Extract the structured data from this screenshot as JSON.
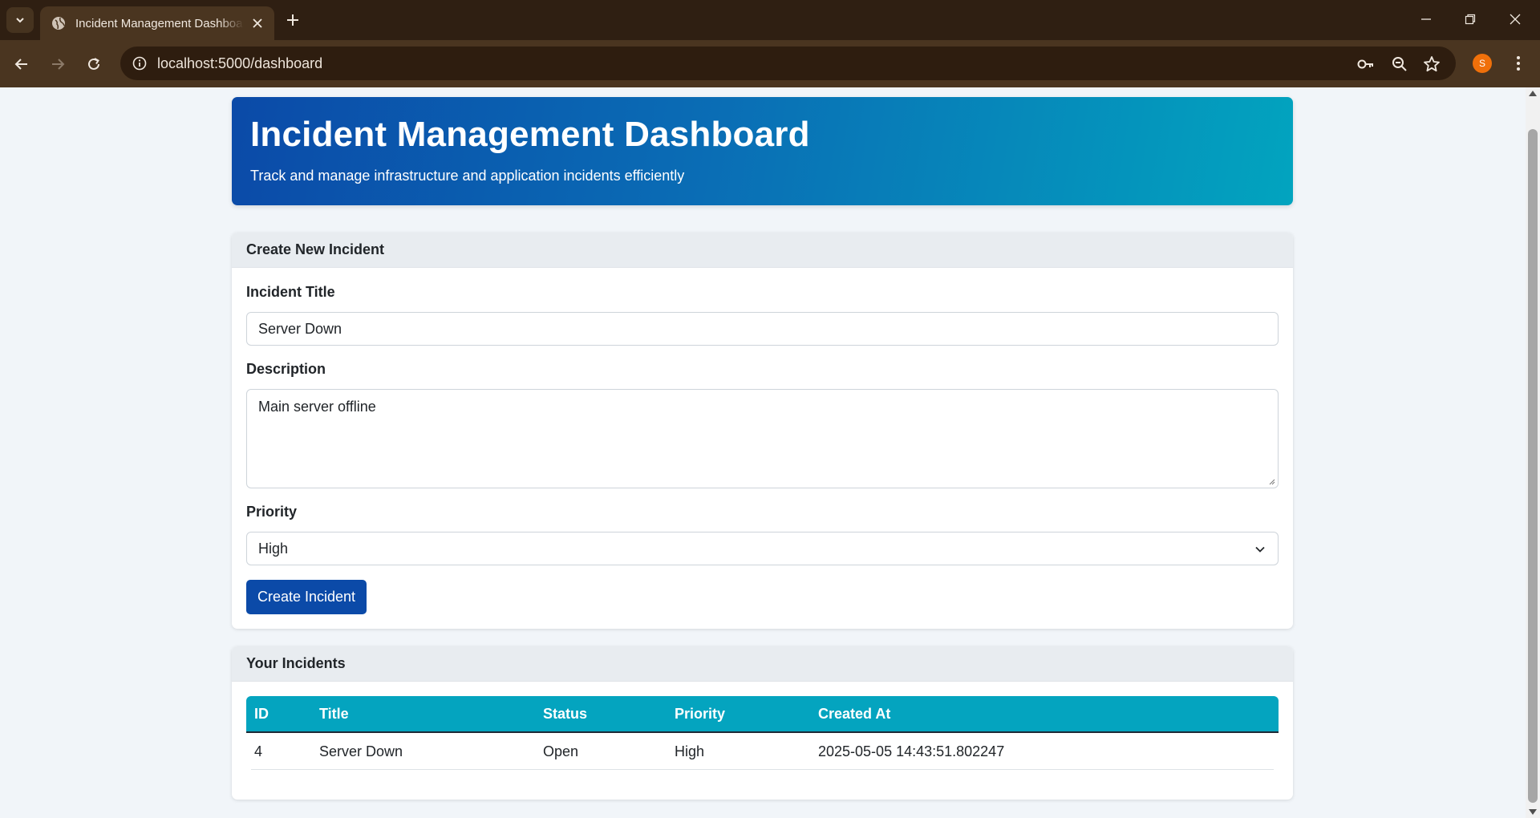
{
  "browser": {
    "tab_title": "Incident Management Dashboard",
    "url": "localhost:5000/dashboard",
    "profile_initial": "S"
  },
  "header": {
    "title": "Incident Management Dashboard",
    "subtitle": "Track and manage infrastructure and application incidents efficiently"
  },
  "create_form": {
    "heading": "Create New Incident",
    "title_label": "Incident Title",
    "title_value": "Server Down",
    "description_label": "Description",
    "description_value": "Main server offline",
    "priority_label": "Priority",
    "priority_value": "High",
    "submit_label": "Create Incident"
  },
  "incidents": {
    "heading": "Your Incidents",
    "columns": [
      "ID",
      "Title",
      "Status",
      "Priority",
      "Created At"
    ],
    "rows": [
      [
        "4",
        "Server Down",
        "Open",
        "High",
        "2025-05-05 14:43:51.802247"
      ]
    ]
  },
  "colors": {
    "brand_blue": "#0b4aa8",
    "teal": "#04a4bf",
    "chrome": "#4a3520"
  }
}
